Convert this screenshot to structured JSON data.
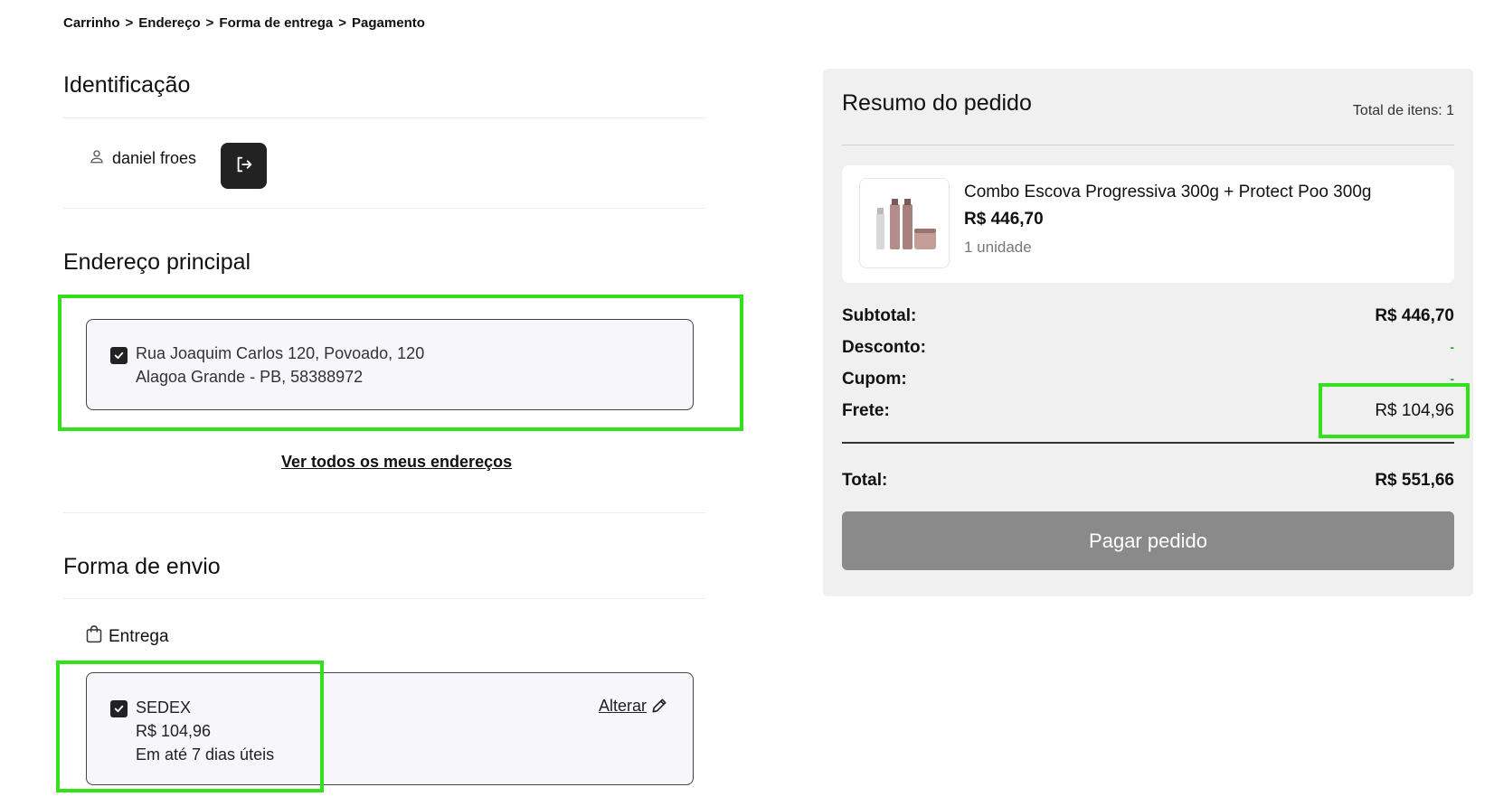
{
  "breadcrumb": {
    "items": [
      "Carrinho",
      "Endereço",
      "Forma de entrega",
      "Pagamento"
    ],
    "separator": ">"
  },
  "identification": {
    "title": "Identificação",
    "user_name": "daniel froes",
    "user_icon": "user-icon",
    "logout_icon": "logout-icon"
  },
  "address": {
    "title": "Endereço principal",
    "line1": "Rua Joaquim Carlos 120, Povoado, 120",
    "line2": "Alagoa Grande - PB, 58388972",
    "checked": true,
    "see_all_label": "Ver todos os meus endereços"
  },
  "shipping": {
    "title": "Forma de envio",
    "method_label": "Entrega",
    "method_icon": "shopping-bag-icon",
    "option_name": "SEDEX",
    "option_price": "R$ 104,96",
    "option_eta": "Em até 7 dias úteis",
    "change_label": "Alterar",
    "checked": true
  },
  "summary": {
    "title": "Resumo do pedido",
    "items_count": "Total de itens: 1",
    "product": {
      "name": "Combo Escova Progressiva 300g + Protect Poo 300g",
      "price": "R$ 446,70",
      "quantity": "1 unidade"
    },
    "subtotal_label": "Subtotal:",
    "subtotal_value": "R$ 446,70",
    "discount_label": "Desconto:",
    "discount_value": "-",
    "coupon_label": "Cupom:",
    "coupon_value": "-",
    "shipping_label": "Frete:",
    "shipping_value": "R$ 104,96",
    "total_label": "Total:",
    "total_value": "R$ 551,66",
    "pay_label": "Pagar pedido"
  },
  "colors": {
    "highlight": "#33e01c",
    "pay_button": "#8a8a8a",
    "panel_bg": "#f0f0f0",
    "dash_green": "#2aa52a"
  }
}
